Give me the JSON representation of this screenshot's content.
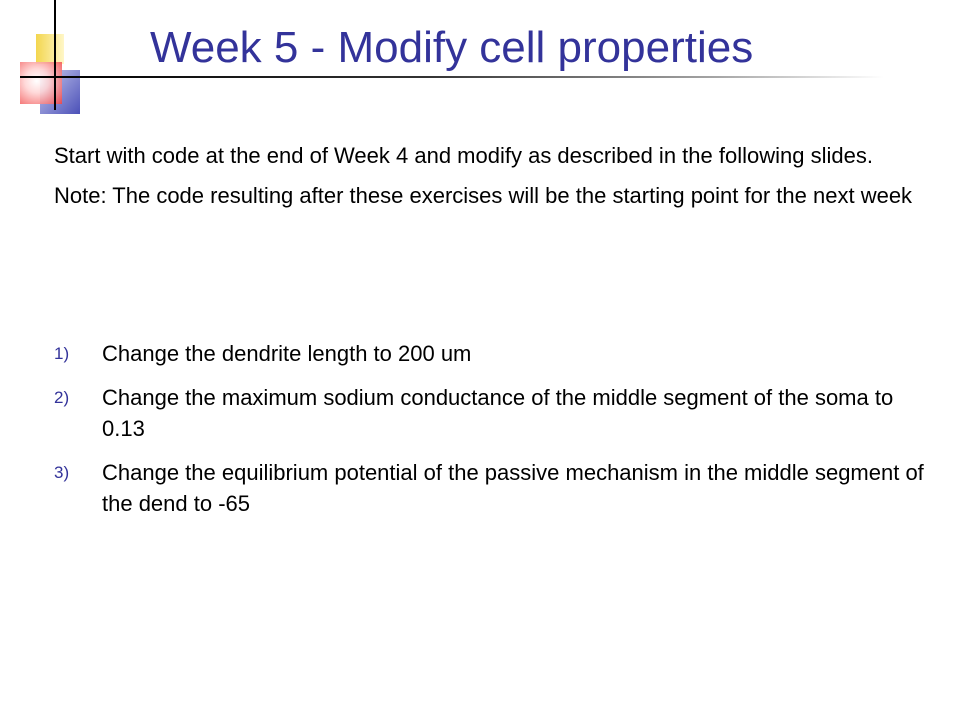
{
  "slide": {
    "title": "Week 5 - Modify cell properties",
    "intro": "Start with code at the end of Week 4 and modify as described in the following slides.",
    "note": "Note: The code resulting after these exercises will be the starting point for the next week",
    "steps": [
      {
        "number": "1)",
        "text": "Change the dendrite length to 200 um"
      },
      {
        "number": "2)",
        "text": "Change the maximum sodium conductance of the middle segment of the soma to 0.13"
      },
      {
        "number": "3)",
        "text": "Change the equilibrium potential of the passive mechanism in the middle segment of the dend to -65"
      }
    ]
  },
  "colors": {
    "title": "#33339a",
    "numbers": "#33339a",
    "body_text": "#000000"
  }
}
